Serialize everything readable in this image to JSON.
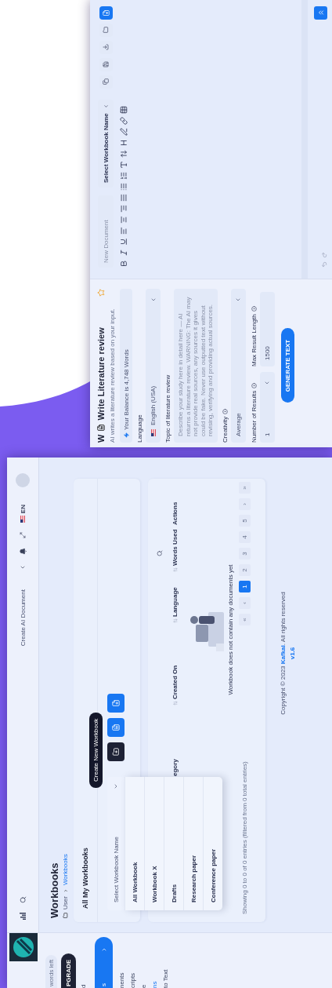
{
  "workbooks_screen": {
    "sidebar": {
      "balance": "words left",
      "upgrade": "PGRADE",
      "items": [
        {
          "label": "d",
          "selected": false,
          "kind": "item"
        },
        {
          "label": "s",
          "selected": true,
          "kind": "group"
        },
        {
          "label": "nents",
          "selected": false,
          "kind": "item"
        },
        {
          "label": "cripts",
          "selected": false,
          "kind": "item"
        },
        {
          "label": "e",
          "selected": false,
          "kind": "item"
        },
        {
          "label": "ns",
          "selected": false,
          "kind": "link"
        },
        {
          "label": "to Text",
          "selected": false,
          "kind": "item"
        }
      ]
    },
    "header": {
      "title": "Create AI Document",
      "language": "EN"
    },
    "page_title": "Workbooks",
    "breadcrumb": [
      "User",
      "Workbooks"
    ],
    "card_title": "All My Workbooks",
    "select": {
      "placeholder": "Select Workbook Name",
      "expanded": true,
      "options": [
        "All Workbook",
        "Workbook X",
        "Drafts",
        "Research paper",
        "Conference paper"
      ]
    },
    "tooltip": "Create New Workbook",
    "columns": [
      "egory",
      "Created On",
      "Language",
      "Words Used",
      "Actions"
    ],
    "empty_text": "Workbook does not contain any documents yet",
    "entries_info": "Showing 0 to 0 of 0 entries (filtered from 0 total entries)",
    "pagination": [
      {
        "label": "«",
        "selected": false
      },
      {
        "label": "‹",
        "selected": false
      },
      {
        "label": "1",
        "selected": true
      },
      {
        "label": "2",
        "selected": false
      },
      {
        "label": "3",
        "selected": false
      },
      {
        "label": "4",
        "selected": false
      },
      {
        "label": "5",
        "selected": false
      },
      {
        "label": "›",
        "selected": false
      },
      {
        "label": "»",
        "selected": false
      }
    ],
    "footer": {
      "copyright": "Copyright © 2023 **Kafkai**. All rights reserved",
      "version": "v1.6"
    }
  },
  "literature_screen": {
    "title_letter": "W",
    "title": "Write Literature review",
    "starred": false,
    "subtitle": "AI writes a literature review based on your input.",
    "balance": "Your Balance is 4,748 Words",
    "language_label": "Language",
    "language": "English (USA)",
    "topic_label": "Topic of literature review",
    "topic_placeholder": "Describe your study here in detail here — AI returns a literature review. WARNING: The AI may not provide real sources, any sources it gives could be fake. Never use outputted text without revising, verifying and providing actual sources.",
    "creativity_label": "Creativity",
    "creativity": "Average",
    "results_label": "Number of Results",
    "results": "1",
    "length_label": "Max Result Length",
    "length": "1500",
    "generate": "GENERATE TEXT",
    "document_placeholder": "New Document",
    "workbook_placeholder": "Select Workbook Name"
  }
}
